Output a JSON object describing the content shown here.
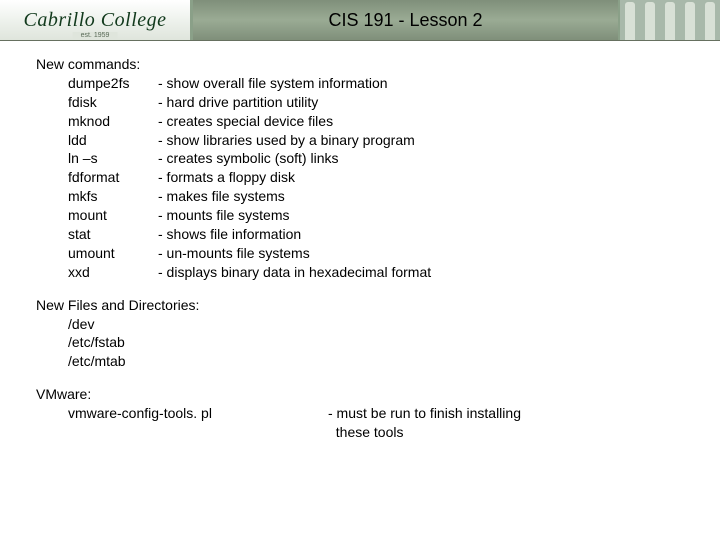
{
  "header": {
    "logo": "Cabrillo College",
    "est": "est. 1959",
    "title": "CIS 191 - Lesson 2"
  },
  "commands": {
    "heading": "New commands:",
    "items": [
      {
        "cmd": "dumpe2fs",
        "desc": "- show overall file system information"
      },
      {
        "cmd": "fdisk",
        "desc": "- hard drive partition utility"
      },
      {
        "cmd": "mknod",
        "desc": "- creates special device files"
      },
      {
        "cmd": "ldd",
        "desc": "- show libraries used by a binary program"
      },
      {
        "cmd": "ln –s",
        "desc": "- creates symbolic (soft) links"
      },
      {
        "cmd": "fdformat",
        "desc": "- formats a floppy disk"
      },
      {
        "cmd": "mkfs",
        "desc": "- makes file systems"
      },
      {
        "cmd": "mount",
        "desc": "- mounts file systems"
      },
      {
        "cmd": "stat",
        "desc": "- shows file information"
      },
      {
        "cmd": "umount",
        "desc": "- un-mounts file systems"
      },
      {
        "cmd": "xxd",
        "desc": "- displays binary data in hexadecimal format"
      }
    ]
  },
  "files": {
    "heading": "New Files and Directories:",
    "items": [
      "/dev",
      "/etc/fstab",
      "/etc/mtab"
    ]
  },
  "vmware": {
    "heading": "VMware:",
    "cmd": "vmware-config-tools. pl",
    "desc1": "- must be run to finish installing",
    "desc2": "  these tools"
  }
}
